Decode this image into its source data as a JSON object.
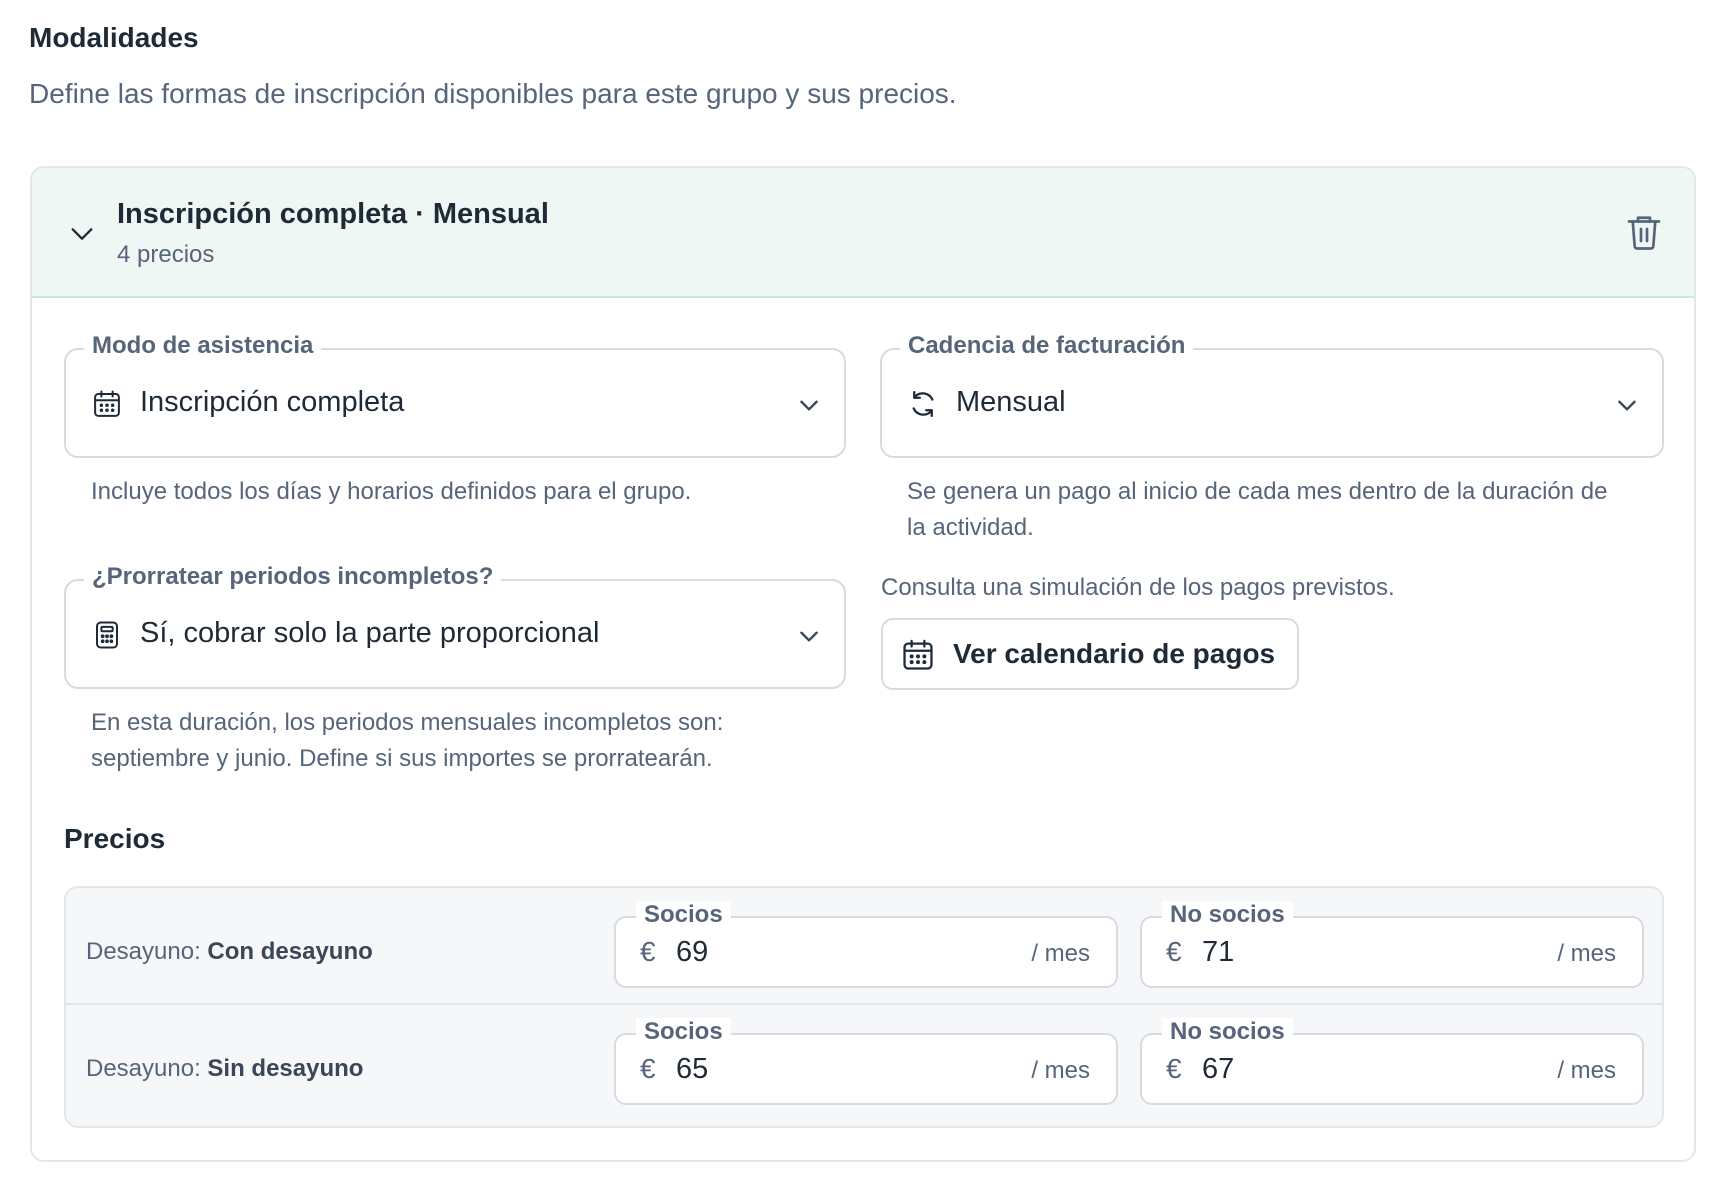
{
  "section": {
    "title": "Modalidades",
    "description": "Define las formas de inscripción disponibles para este grupo y sus precios."
  },
  "card": {
    "title": "Inscripción completa · Mensual",
    "subtitle": "4 precios",
    "header_color": "#eef7f4",
    "expand_icon": "chevron-down-icon",
    "delete_icon": "trash-icon"
  },
  "fields": {
    "attendance": {
      "label": "Modo de asistencia",
      "value": "Inscripción completa",
      "icon": "calendar-icon",
      "helper": "Incluye todos los días y horarios definidos para el grupo."
    },
    "billing": {
      "label": "Cadencia de facturación",
      "value": "Mensual",
      "icon": "refresh-icon",
      "helper_line1": "Se genera un pago al inicio de cada mes dentro de la duración de",
      "helper_line2": "la actividad."
    },
    "prorate": {
      "label": "¿Prorratear periodos incompletos?",
      "value": "Sí, cobrar solo la parte proporcional",
      "icon": "calculator-icon",
      "helper_line1": "En esta duración, los periodos mensuales incompletos son:",
      "helper_line2": "septiembre y junio. Define si sus importes se prorratearán."
    }
  },
  "simulation": {
    "text": "Consulta una simulación de los pagos previstos.",
    "button_label": "Ver calendario de pagos",
    "button_icon": "calendar-icon"
  },
  "prices": {
    "title": "Precios",
    "rows": [
      {
        "label_prefix": "Desayuno:",
        "label_value": "Con desayuno",
        "socios": {
          "label": "Socios",
          "currency": "€",
          "value": "69",
          "unit": "/ mes"
        },
        "no_socios": {
          "label": "No socios",
          "currency": "€",
          "value": "71",
          "unit": "/ mes"
        }
      },
      {
        "label_prefix": "Desayuno:",
        "label_value": "Sin desayuno",
        "socios": {
          "label": "Socios",
          "currency": "€",
          "value": "65",
          "unit": "/ mes"
        },
        "no_socios": {
          "label": "No socios",
          "currency": "€",
          "value": "67",
          "unit": "/ mes"
        }
      }
    ]
  }
}
